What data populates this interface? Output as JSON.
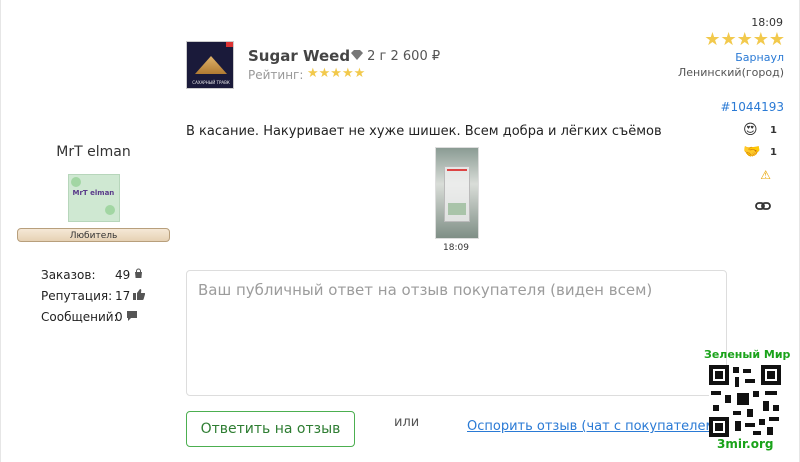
{
  "user": {
    "name": "MrT elman",
    "avatar_text": "MrT elman",
    "rank": "Любитель",
    "stats": [
      {
        "label": "Заказов:",
        "value": "49",
        "icon": "bag-icon"
      },
      {
        "label": "Репутация:",
        "value": "17",
        "icon": "thumbs-up-icon"
      },
      {
        "label": "Сообщений:",
        "value": "0",
        "icon": "chat-icon"
      }
    ]
  },
  "product": {
    "title": "Sugar Weed",
    "price": "2 г 2 600 ₽",
    "rating_label": "Рейтинг:",
    "rating_stars": "★★★★★",
    "image_caption": "САХАРНЫЙ ТРАВК"
  },
  "meta": {
    "time": "18:09",
    "stars": "★★★★★",
    "city": "Барнаул",
    "district": "Ленинский(город)",
    "review_id": "#1044193"
  },
  "reactions": [
    {
      "emoji": "😍",
      "count": "1"
    },
    {
      "emoji": "🤝",
      "count": "1"
    }
  ],
  "icons": {
    "warning": "⚠",
    "link": "🔗"
  },
  "review": {
    "text": "В касание. Накуривает не хуже шишек. Всем добра и лёгких съёмов",
    "photo_time": "18:09"
  },
  "reply": {
    "placeholder": "Ваш публичный ответ на отзыв покупателя (виден всем)",
    "button": "Ответить на отзыв",
    "or": "или",
    "dispute": "Оспорить отзыв (чат с покупателем)"
  },
  "watermark": {
    "title": "Зеленый Мир",
    "url": "3mir.org"
  },
  "colors": {
    "accent": "#2a7ad5",
    "green": "#4caf50",
    "star": "#f2c94c"
  }
}
